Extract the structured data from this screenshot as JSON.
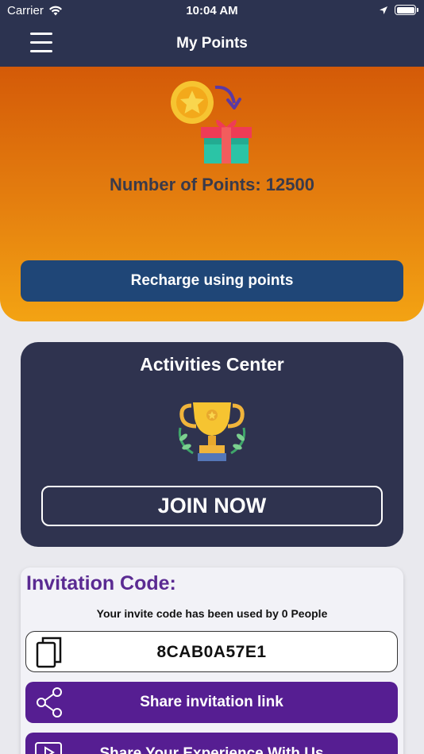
{
  "status_bar": {
    "carrier": "Carrier",
    "time": "10:04 AM",
    "icons": [
      "wifi-icon",
      "location-icon",
      "battery-icon"
    ]
  },
  "nav": {
    "title": "My Points",
    "menu_icon": "hamburger-menu-icon"
  },
  "hero": {
    "icon": "coin-to-gift-icon",
    "points_text": "Number of Points: 12500",
    "recharge_label": "Recharge using points"
  },
  "activities": {
    "title": "Activities Center",
    "icon": "trophy-icon",
    "join_label": "JOIN NOW"
  },
  "invitation": {
    "title": "Invitation Code:",
    "used_text": "Your invite code has been used by 0 People",
    "code": "8CAB0A57E1",
    "copy_icon": "copy-icon",
    "share_label": "Share invitation link",
    "share_icon": "share-icon",
    "experience_label": "Share Your Experience With Us",
    "experience_icon": "video-play-icon"
  },
  "colors": {
    "nav_bg": "#2c3350",
    "hero_top": "#d45a08",
    "hero_bottom": "#f3a313",
    "recharge_bg": "#1f4677",
    "activities_bg": "#2f334f",
    "invite_title": "#5a2a92",
    "share_bg": "#561e92"
  }
}
